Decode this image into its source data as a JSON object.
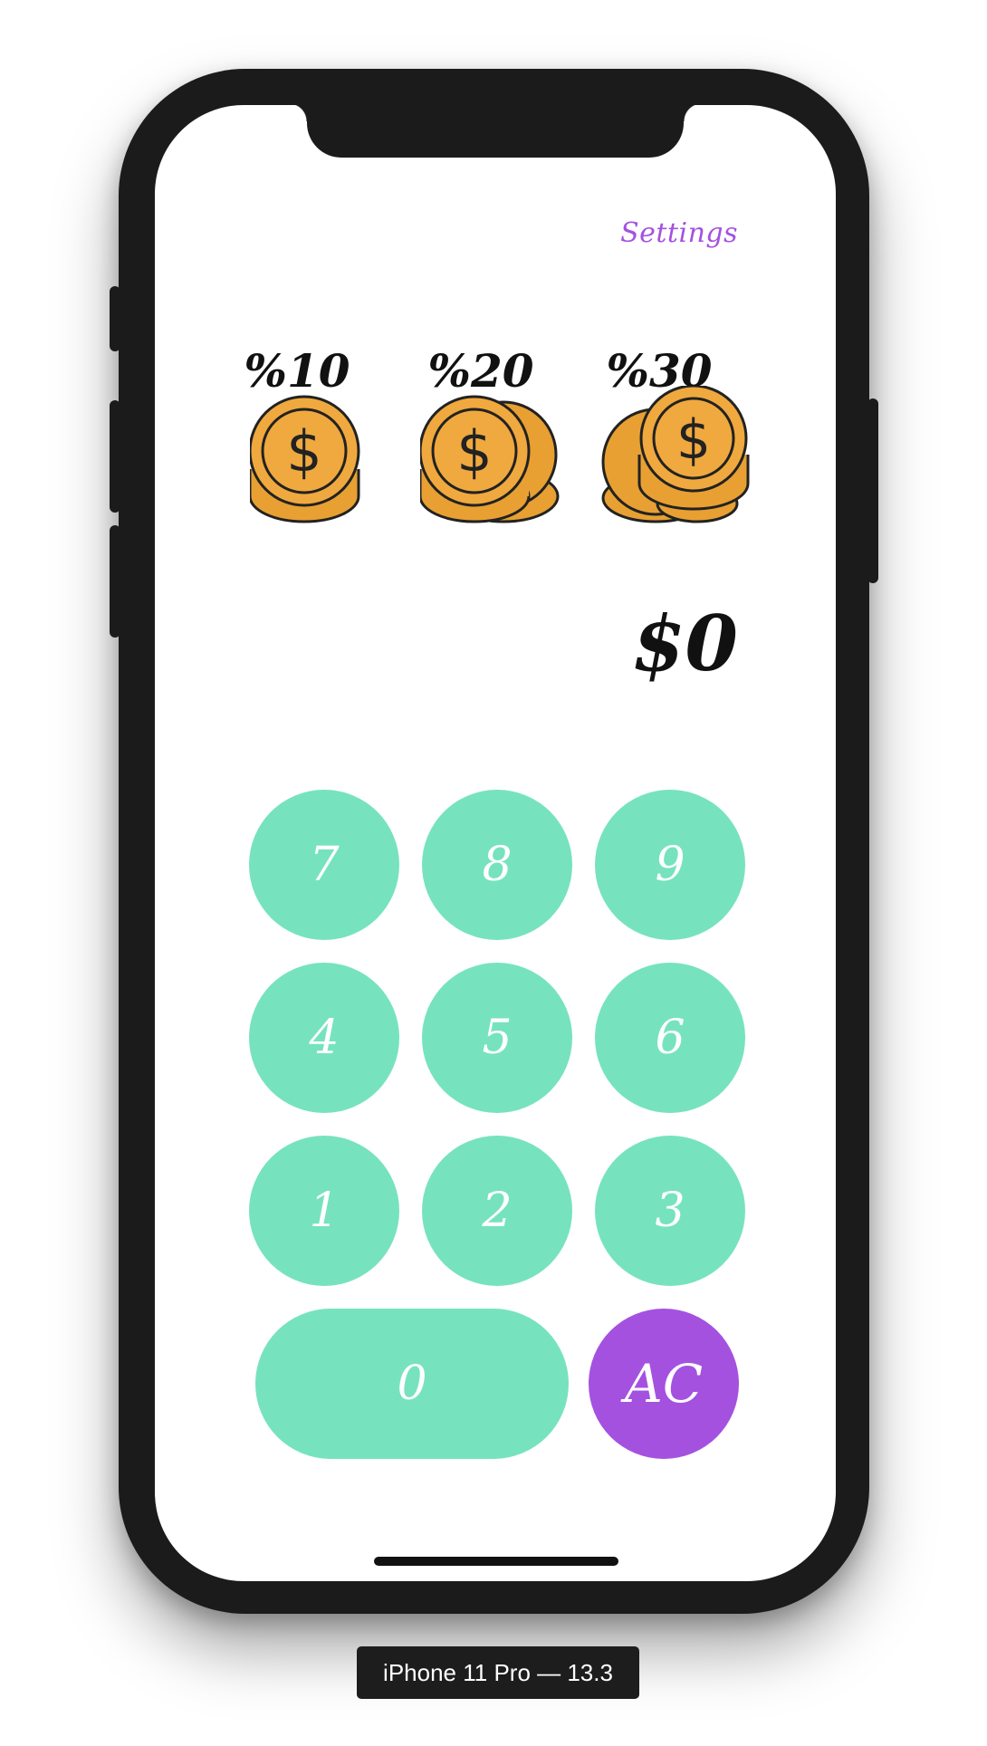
{
  "app": {
    "settings_label": "Settings",
    "tips": [
      {
        "label": "%10",
        "coins": 1
      },
      {
        "label": "%20",
        "coins": 2
      },
      {
        "label": "%30",
        "coins": 3
      }
    ],
    "total": "$0",
    "keypad": {
      "rows": [
        [
          "7",
          "8",
          "9"
        ],
        [
          "4",
          "5",
          "6"
        ],
        [
          "1",
          "2",
          "3"
        ]
      ],
      "zero": "0",
      "clear": "AC"
    }
  },
  "simulator": {
    "device_label": "iPhone 11 Pro — 13.3"
  },
  "colors": {
    "accent": "#a451e0",
    "key": "#76e3be",
    "coin": "#f0a93e",
    "device_frame": "#1b1b1b"
  }
}
